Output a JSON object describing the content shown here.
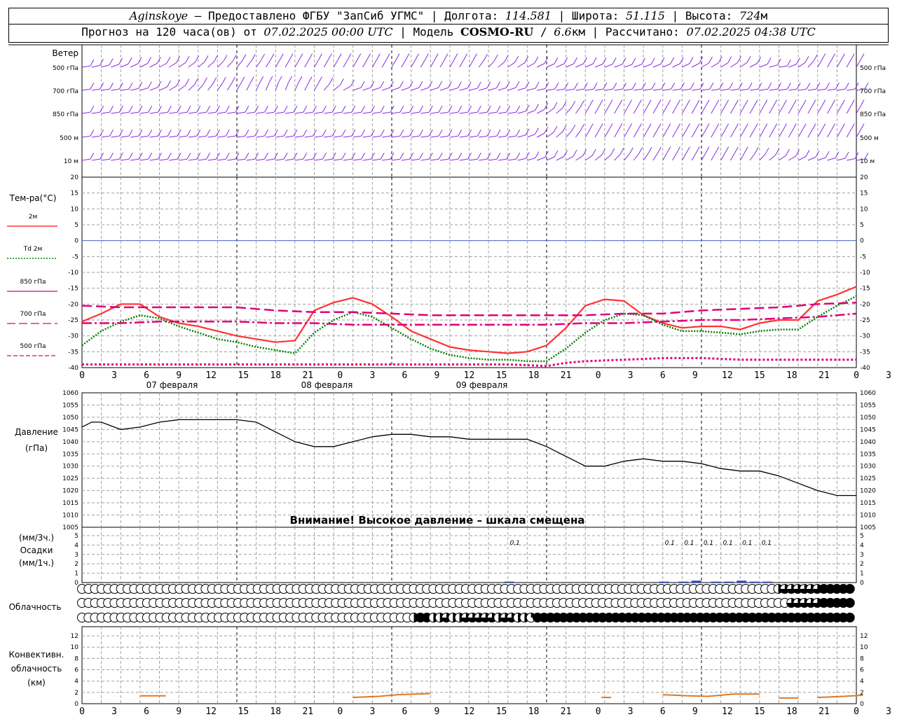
{
  "header": {
    "station": "Aginskoye",
    "provider": " – Предоставлено ФГБУ \"ЗапСиб УГМС\" | Долгота: ",
    "longitude": "114.581",
    "lat_label": " | Широта: ",
    "latitude": "51.115",
    "alt_label": " | Высота: ",
    "altitude": "724",
    "alt_unit": "м",
    "forecast_prefix": "Прогноз на 120 часа(ов) от ",
    "forecast_from": "07.02.2025 00:00 UTC",
    "model_label": "  | Модель ",
    "model": "COSMO-RU",
    "model_sep": " / ",
    "resolution": "6.6",
    "res_unit": "км",
    "calc_label": " | Рассчитано: ",
    "calculated": "07.02.2025 04:38 UTC"
  },
  "colors": {
    "t2m": "#ff3333",
    "td2m": "#008000",
    "t850": "#e0007a",
    "t700": "#e0007a",
    "t500": "#e0007a",
    "wind": "#8a2be2",
    "zero_line": "#4a6ad0",
    "precip": "#2244cc",
    "conv": "#e07820",
    "grid": "#a0a0a0"
  },
  "x_axis": {
    "ticks": [
      "0",
      "3",
      "6",
      "9",
      "12",
      "15",
      "18",
      "21",
      "0",
      "3",
      "6",
      "9",
      "12",
      "15",
      "18",
      "21",
      "0",
      "3",
      "6",
      "9",
      "12",
      "15",
      "18",
      "21",
      "0",
      "3",
      "6"
    ],
    "days": [
      "07 февраля",
      "08 февраля",
      "09 февраля"
    ]
  },
  "wind_panel": {
    "title": "Ветер",
    "levels": [
      "500 гПа",
      "700 гПа",
      "850 гПа",
      "500 м",
      "10  м"
    ]
  },
  "temp_panel": {
    "title": "Тем-ра(°C)",
    "legend": [
      {
        "name": "2м",
        "style": "solid",
        "color": "#ff3333"
      },
      {
        "name": "Td 2м",
        "style": "dot",
        "color": "#008000"
      },
      {
        "name": "850 гПа",
        "style": "solid",
        "color": "#e0007a"
      },
      {
        "name": "700 гПа",
        "style": "dash",
        "color": "#e0007a"
      },
      {
        "name": "500 гПа",
        "style": "dash",
        "color": "#e0007a"
      }
    ],
    "y_ticks": [
      "20",
      "15",
      "10",
      "5",
      "0",
      "-5",
      "-10",
      "-15",
      "-20",
      "-25",
      "-30",
      "-35",
      "-40"
    ]
  },
  "pressure_panel": {
    "title": "Давление",
    "unit": "(гПа)",
    "warning": "Внимание! Высокое давление – шкала смещена",
    "y_ticks": [
      "1060",
      "1055",
      "1050",
      "1045",
      "1040",
      "1035",
      "1030",
      "1025",
      "1020",
      "1015",
      "1010",
      "1005"
    ]
  },
  "precip_panel": {
    "unit3": "(мм/3ч.)",
    "title": "Осадки",
    "unit1": "(мм/1ч.)",
    "y_ticks": [
      "5",
      "4",
      "3",
      "2",
      "1",
      "0"
    ],
    "labels": [
      {
        "hour": 66,
        "text": "0.1"
      },
      {
        "hour": 90,
        "text": "0.1"
      },
      {
        "hour": 93,
        "text": "0.1"
      },
      {
        "hour": 96,
        "text": "0.1"
      },
      {
        "hour": 99,
        "text": "0.1"
      },
      {
        "hour": 102,
        "text": "0.1"
      },
      {
        "hour": 105,
        "text": "0.1"
      }
    ],
    "bars": [
      {
        "hour": 66,
        "value": 0.1
      },
      {
        "hour": 90,
        "value": 0.1
      },
      {
        "hour": 93,
        "value": 0.1
      },
      {
        "hour": 95,
        "value": 0.2
      },
      {
        "hour": 98,
        "value": 0.1
      },
      {
        "hour": 100,
        "value": 0.1
      },
      {
        "hour": 102,
        "value": 0.2
      },
      {
        "hour": 104,
        "value": 0.1
      },
      {
        "hour": 106,
        "value": 0.1
      }
    ]
  },
  "cloud_panel": {
    "title": "Облачность",
    "rows": [
      "00000000000000000000000000000000000000000000000000000000000000000000000000000000000000000000000000000000000233333344444",
      "00000000000000000000000000000000000000000000000000000000000000000000000000000000000000000000000000000000000003333344444",
      "00000000000000000000000000000000000000000000000000024422322333332332214444444444444444444444444444444444444444444444444"
    ]
  },
  "conv_panel": {
    "line1": "Конвективн.",
    "line2": "облачность",
    "unit": "(км)",
    "y_ticks": [
      "12",
      "10",
      "8",
      "6",
      "4",
      "2",
      "0"
    ]
  },
  "chart_data": [
    {
      "type": "line",
      "title": "Тем-ра(°C)",
      "ylim": [
        -40,
        20
      ],
      "series": [
        {
          "name": "2м",
          "x": [
            0,
            3,
            6,
            9,
            12,
            15,
            18,
            21,
            24,
            27,
            30,
            33,
            36,
            39,
            42,
            45,
            48,
            51,
            54,
            57,
            60,
            63,
            66,
            69,
            72,
            75,
            78,
            81,
            84,
            87,
            90,
            93,
            96,
            99,
            102,
            105,
            108,
            111,
            114,
            117,
            120
          ],
          "y": [
            -25.5,
            -23,
            -20,
            -20,
            -24,
            -26,
            -27,
            -28.5,
            -30,
            -31,
            -32,
            -31.5,
            -22,
            -19.5,
            -18,
            -20,
            -24,
            -28.5,
            -31,
            -33.5,
            -34.5,
            -35,
            -35.5,
            -35,
            -33,
            -27.5,
            -20.5,
            -18.5,
            -19,
            -23.5,
            -26,
            -27.5,
            -27,
            -27,
            -28,
            -26,
            -25,
            -25,
            -19,
            -17,
            -14.5
          ]
        },
        {
          "name": "Td 2м",
          "x": [
            0,
            3,
            6,
            9,
            12,
            15,
            18,
            21,
            24,
            27,
            30,
            33,
            36,
            39,
            42,
            45,
            48,
            51,
            54,
            57,
            60,
            63,
            66,
            69,
            72,
            75,
            78,
            81,
            84,
            87,
            90,
            93,
            96,
            99,
            102,
            105,
            108,
            111,
            114,
            117,
            120
          ],
          "y": [
            -33,
            -28.5,
            -25.5,
            -23.5,
            -24.5,
            -27,
            -29,
            -31,
            -32,
            -33.5,
            -34.5,
            -35.5,
            -29,
            -25,
            -22.5,
            -24,
            -27.5,
            -31,
            -34,
            -36,
            -37,
            -37.5,
            -37.5,
            -38,
            -38,
            -34,
            -29,
            -25,
            -23,
            -23.5,
            -26.5,
            -28.5,
            -28.5,
            -29,
            -29.5,
            -28.5,
            -28,
            -28,
            -24,
            -20.5,
            -17.5
          ]
        },
        {
          "name": "850 гПа",
          "x": [
            0,
            6,
            12,
            18,
            24,
            30,
            36,
            42,
            48,
            54,
            60,
            66,
            72,
            78,
            84,
            90,
            96,
            102,
            108,
            114,
            120
          ],
          "y": [
            -26,
            -26,
            -25.5,
            -25.5,
            -25.5,
            -26,
            -26,
            -26.5,
            -26.5,
            -26.5,
            -26.5,
            -26.5,
            -26.5,
            -26,
            -26,
            -25.5,
            -25,
            -25,
            -24.5,
            -24,
            -23
          ]
        },
        {
          "name": "700 гПа",
          "x": [
            0,
            6,
            12,
            18,
            24,
            30,
            36,
            42,
            48,
            54,
            60,
            66,
            72,
            78,
            84,
            90,
            96,
            102,
            108,
            114,
            120
          ],
          "y": [
            -20.5,
            -21,
            -21,
            -21,
            -21,
            -22,
            -22.5,
            -22.5,
            -23,
            -23.5,
            -23.5,
            -23.5,
            -23.5,
            -23.5,
            -23,
            -23,
            -22,
            -21.5,
            -21,
            -20,
            -19.5
          ]
        },
        {
          "name": "500 гПа",
          "x": [
            0,
            6,
            12,
            18,
            24,
            30,
            36,
            42,
            48,
            54,
            60,
            66,
            72,
            75,
            78,
            84,
            90,
            96,
            102,
            108,
            114,
            120
          ],
          "y": [
            -39,
            -39,
            -39,
            -39,
            -39,
            -39,
            -39,
            -39,
            -39,
            -39,
            -39,
            -39,
            -39.5,
            -38.5,
            -38,
            -37.5,
            -37,
            -37,
            -37.5,
            -37.5,
            -37.5,
            -37.5
          ]
        }
      ]
    },
    {
      "type": "line",
      "title": "Давление",
      "ylim": [
        1005,
        1060
      ],
      "series": [
        {
          "name": "Давление",
          "x": [
            0,
            1.5,
            3,
            6,
            9,
            12,
            15,
            18,
            21,
            24,
            27,
            30,
            33,
            36,
            39,
            42,
            45,
            48,
            51,
            54,
            57,
            60,
            63,
            66,
            69,
            72,
            75,
            78,
            81,
            84,
            87,
            90,
            93,
            96,
            99,
            102,
            105,
            108,
            111,
            114,
            117,
            120
          ],
          "y": [
            1046,
            1048,
            1048,
            1045,
            1046,
            1048,
            1049,
            1049,
            1049,
            1049,
            1048,
            1044,
            1040,
            1038,
            1038,
            1040,
            1042,
            1043,
            1043,
            1042,
            1042,
            1041,
            1041,
            1041,
            1041,
            1038,
            1034,
            1030,
            1030,
            1032,
            1033,
            1032,
            1032,
            1031,
            1029,
            1028,
            1028,
            1026,
            1023,
            1020,
            1018,
            1018
          ]
        }
      ]
    },
    {
      "type": "area",
      "title": "Конвективн. облачность",
      "ylim": [
        0,
        13
      ],
      "series": [
        {
          "name": "seg1",
          "x": [
            9,
            13
          ],
          "y": [
            1.4,
            1.4
          ]
        },
        {
          "name": "seg2",
          "x": [
            42,
            46,
            49,
            54
          ],
          "y": [
            1.1,
            1.3,
            1.6,
            1.8
          ]
        },
        {
          "name": "seg3",
          "x": [
            80.5,
            82
          ],
          "y": [
            1.1,
            1.1
          ]
        },
        {
          "name": "seg4",
          "x": [
            90,
            94,
            97,
            101,
            105
          ],
          "y": [
            1.6,
            1.4,
            1.3,
            1.7,
            1.7
          ]
        },
        {
          "name": "seg5",
          "x": [
            108,
            111
          ],
          "y": [
            1.0,
            1.0
          ]
        },
        {
          "name": "seg6",
          "x": [
            114,
            118,
            121
          ],
          "y": [
            1.1,
            1.3,
            1.5
          ]
        }
      ]
    },
    {
      "type": "line",
      "title": "Ветер",
      "series": [
        {
          "name": "500 гПа",
          "x": [
            0,
            6,
            12,
            18,
            24,
            30,
            36,
            42,
            48,
            54,
            60,
            66,
            72,
            78,
            84,
            90,
            96,
            102,
            108,
            114,
            120
          ],
          "y": [
            0.0,
            0.3,
            0.4,
            0.6,
            0.8,
            1.0,
            1.0,
            1.0,
            1.0,
            1.0,
            1.0,
            0.5,
            0.3,
            0.3,
            0.2,
            0.3,
            0.4,
            0.5,
            0.0,
            1.0,
            1.0
          ]
        },
        {
          "name": "700 гПа",
          "x": [
            0,
            6,
            12,
            18,
            24,
            30,
            36,
            42,
            48,
            54,
            60,
            66,
            72,
            78,
            84,
            90,
            96,
            102,
            108,
            114,
            120
          ],
          "y": [
            0.0,
            0.0,
            0.3,
            0.8,
            1.0,
            1.2,
            1.0,
            0.2,
            0.2,
            0.2,
            0.1,
            0.2,
            0.0,
            0.0,
            0.0,
            0.0,
            0.0,
            0.0,
            0.0,
            0.0,
            0.0
          ]
        },
        {
          "name": "850 гПа",
          "x": [
            0,
            6,
            12,
            18,
            24,
            30,
            36,
            42,
            48,
            54,
            60,
            66,
            72,
            78,
            84,
            90,
            96,
            102,
            108,
            114,
            120
          ],
          "y": [
            0.0,
            0.0,
            0.0,
            0.0,
            0.0,
            0.0,
            0.0,
            0.0,
            0.0,
            0.0,
            0.0,
            0.0,
            0.5,
            1.0,
            1.0,
            1.0,
            1.0,
            1.0,
            1.0,
            1.0,
            1.0
          ]
        },
        {
          "name": "500 м",
          "x": [
            0,
            6,
            12,
            18,
            24,
            30,
            36,
            42,
            48,
            54,
            60,
            66,
            72,
            78,
            84,
            90,
            96,
            102,
            108,
            114,
            120
          ],
          "y": [
            0.0,
            0.0,
            0.0,
            0.0,
            0.0,
            0.0,
            0.0,
            0.0,
            0.0,
            0.0,
            0.0,
            0.0,
            0.5,
            1.0,
            1.0,
            1.0,
            1.0,
            1.0,
            1.0,
            1.0,
            1.0
          ]
        },
        {
          "name": "10 м",
          "x": [
            0,
            6,
            12,
            18,
            24,
            30,
            36,
            42,
            48,
            54,
            60,
            66,
            72,
            78,
            84,
            90,
            96,
            102,
            108,
            114,
            120
          ],
          "y": [
            0.0,
            0.0,
            0.0,
            0.0,
            0.0,
            0.0,
            0.0,
            0.0,
            0.0,
            0.0,
            0.0,
            0.0,
            0.3,
            0.5,
            0.8,
            1.0,
            1.0,
            1.0,
            0.5,
            0.2,
            0.0
          ]
        }
      ]
    }
  ]
}
